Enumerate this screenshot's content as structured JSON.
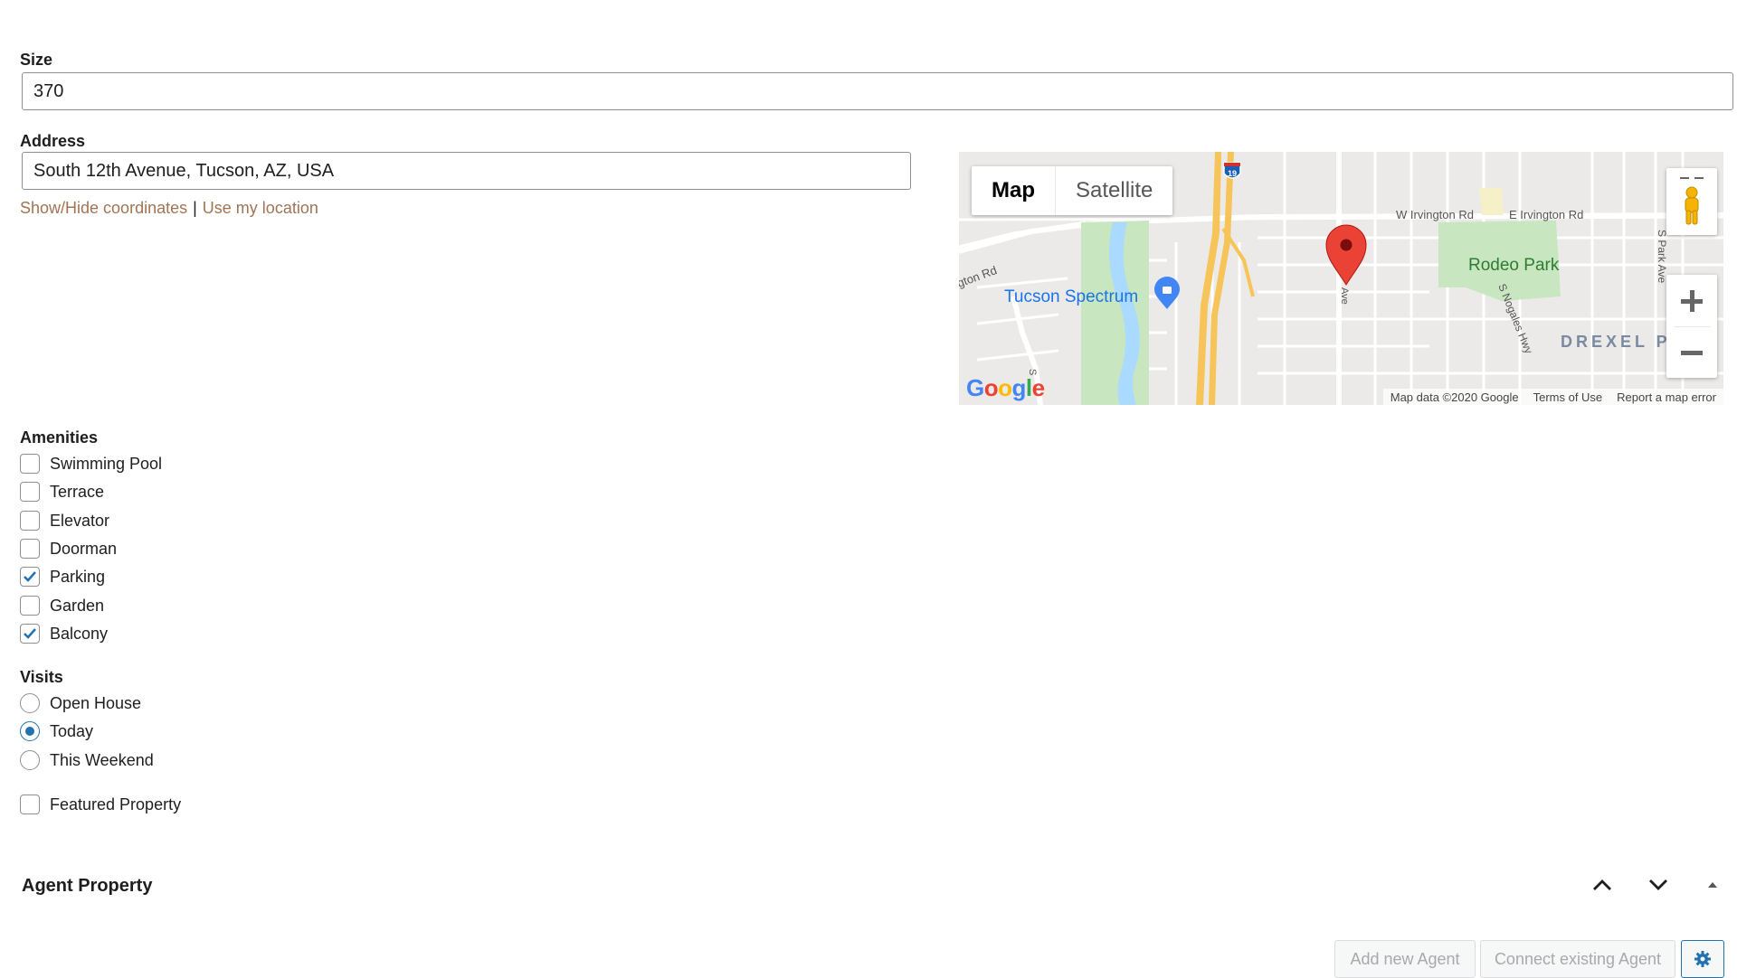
{
  "size": {
    "label": "Size",
    "value": "370"
  },
  "address": {
    "label": "Address",
    "value": "South 12th Avenue, Tucson, AZ, USA",
    "toggle_coords_link": "Show/Hide coordinates",
    "separator": "|",
    "my_location_link": "Use my location"
  },
  "map": {
    "type_map": "Map",
    "type_satellite": "Satellite",
    "labels": {
      "w_irvington": "W Irvington Rd",
      "e_irvington": "E Irvington Rd",
      "irvington_left": "gton Rd",
      "rodeo_park": "Rodeo Park",
      "tucson_spectrum": "Tucson Spectrum",
      "s_park_ave": "S Park Ave",
      "s_nogales": "S Nogales Hwy",
      "drexel": "DREXEL P",
      "highway": "19",
      "ave": "Ave",
      "s_small": "S"
    },
    "google_logo": "Google",
    "footer": {
      "map_data": "Map data ©2020 Google",
      "terms": "Terms of Use",
      "report": "Report a map error"
    },
    "colors": {
      "background": "#ebeae8",
      "park": "#c8e6c0",
      "water": "#aadaff",
      "highway": "#f7c45a",
      "marker": "#ea4335"
    }
  },
  "amenities": {
    "label": "Amenities",
    "items": [
      {
        "label": "Swimming Pool",
        "checked": false
      },
      {
        "label": "Terrace",
        "checked": false
      },
      {
        "label": "Elevator",
        "checked": false
      },
      {
        "label": "Doorman",
        "checked": false
      },
      {
        "label": "Parking",
        "checked": true
      },
      {
        "label": "Garden",
        "checked": false
      },
      {
        "label": "Balcony",
        "checked": true
      }
    ]
  },
  "visits": {
    "label": "Visits",
    "options": [
      {
        "label": "Open House",
        "selected": false
      },
      {
        "label": "Today",
        "selected": true
      },
      {
        "label": "This Weekend",
        "selected": false
      }
    ]
  },
  "featured": {
    "label": "Featured Property",
    "checked": false
  },
  "agent": {
    "title": "Agent Property",
    "add_button": "Add new Agent",
    "connect_button": "Connect existing Agent"
  },
  "colors": {
    "link": "#a07454",
    "accent": "#2271b1",
    "border": "#8c8f94"
  }
}
